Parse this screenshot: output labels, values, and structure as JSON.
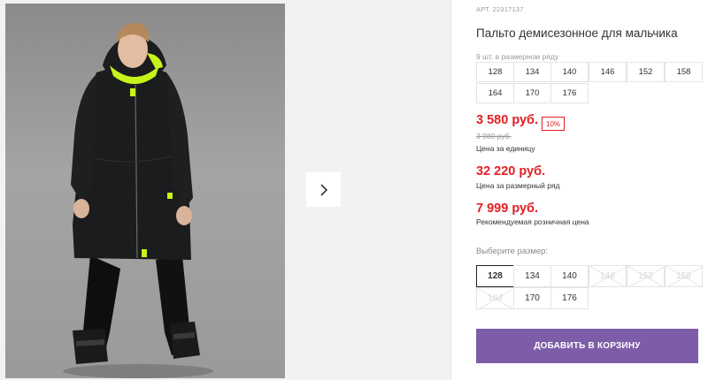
{
  "gallery": {
    "photo_alt": "Пальто демисезонное для мальчика",
    "next_icon": "chevron-right-icon"
  },
  "product": {
    "article": "АРТ. 22317137",
    "title": "Пальто демисезонное для мальчика",
    "size_row_note": "9 шт. в размерном ряду",
    "size_row": [
      "128",
      "134",
      "140",
      "146",
      "152",
      "158",
      "164",
      "170",
      "176"
    ]
  },
  "pricing": {
    "unit_price": "3 580 руб.",
    "discount": "10%",
    "old_price": "3 980 руб.",
    "unit_label": "Цена за единицу",
    "row_price": "32 220 руб.",
    "row_label": "Цена за размерный ряд",
    "recommended_price": "7 999 руб.",
    "recommended_label": "Рекомендуемая розничная цена"
  },
  "size_picker": {
    "label": "Выберите размер:",
    "sizes": [
      {
        "value": "128",
        "state": "selected"
      },
      {
        "value": "134",
        "state": "available"
      },
      {
        "value": "140",
        "state": "available"
      },
      {
        "value": "146",
        "state": "unavailable"
      },
      {
        "value": "152",
        "state": "unavailable"
      },
      {
        "value": "158",
        "state": "unavailable"
      },
      {
        "value": "164",
        "state": "unavailable"
      },
      {
        "value": "170",
        "state": "available"
      },
      {
        "value": "176",
        "state": "available"
      }
    ]
  },
  "cart": {
    "label": "ДОБАВИТЬ В КОРЗИНУ"
  },
  "colors": {
    "accent_price": "#e31e24",
    "button": "#7e5da8",
    "neon_detail": "#c6f31a"
  }
}
